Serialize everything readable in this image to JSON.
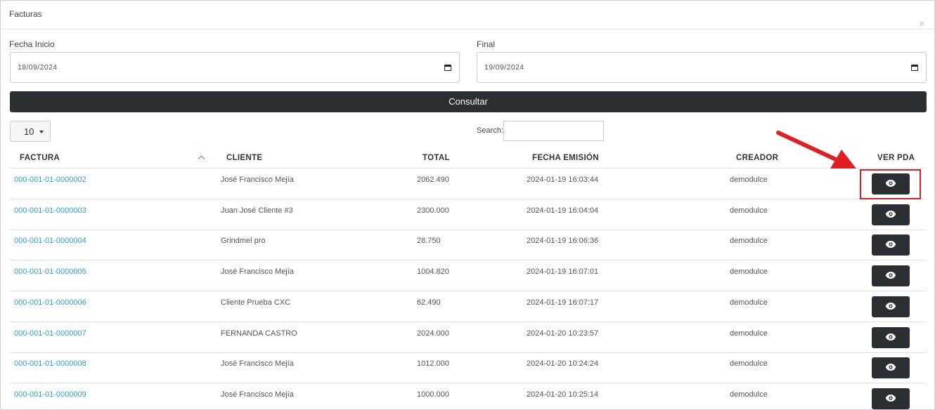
{
  "modal": {
    "title": "Facturas",
    "close_glyph": "×"
  },
  "filters": {
    "start_label": "Fecha Inicio",
    "start_value": "18/09/2024",
    "end_label": "Final",
    "end_value": "19/09/2024",
    "submit_label": "Consultar"
  },
  "table_controls": {
    "page_size": "10",
    "search_label": "Search:",
    "search_value": ""
  },
  "table": {
    "columns": [
      "FACTURA",
      "CLIENTE",
      "TOTAL",
      "FECHA EMISIÓN",
      "CREADOR",
      "VER PDA"
    ],
    "rows": [
      {
        "factura": "000-001-01-0000002",
        "cliente": "José Francisco Mejía",
        "total": "2062.490",
        "fecha": "2024-01-19 16:03:44",
        "creador": "demodulce"
      },
      {
        "factura": "000-001-01-0000003",
        "cliente": "Juan José Cliente #3",
        "total": "2300.000",
        "fecha": "2024-01-19 16:04:04",
        "creador": "demodulce"
      },
      {
        "factura": "000-001-01-0000004",
        "cliente": "Grindmel pro",
        "total": "28.750",
        "fecha": "2024-01-19 16:06:36",
        "creador": "demodulce"
      },
      {
        "factura": "000-001-01-0000005",
        "cliente": "José Francisco Mejía",
        "total": "1004.820",
        "fecha": "2024-01-19 16:07:01",
        "creador": "demodulce"
      },
      {
        "factura": "000-001-01-0000006",
        "cliente": "Cliente Prueba CXC",
        "total": "62.490",
        "fecha": "2024-01-19 16:07:17",
        "creador": "demodulce"
      },
      {
        "factura": "000-001-01-0000007",
        "cliente": "FERNANDA CASTRO",
        "total": "2024.000",
        "fecha": "2024-01-20 10:23:57",
        "creador": "demodulce"
      },
      {
        "factura": "000-001-01-0000008",
        "cliente": "José Francisco Mejía",
        "total": "1012.000",
        "fecha": "2024-01-20 10:24:24",
        "creador": "demodulce"
      },
      {
        "factura": "000-001-01-0000009",
        "cliente": "José Francisco Mejía",
        "total": "1000.000",
        "fecha": "2024-01-20 10:25:14",
        "creador": "demodulce"
      }
    ]
  },
  "icons": {
    "view": "eye-icon",
    "calendar": "calendar-icon",
    "sort": "sort-ascending-icon",
    "dropdown": "caret-down-icon"
  },
  "colors": {
    "link": "#2a9fd6",
    "dark_button": "#2b2f33",
    "annotation": "#e02020",
    "sort_indicator": "#d9534f"
  }
}
